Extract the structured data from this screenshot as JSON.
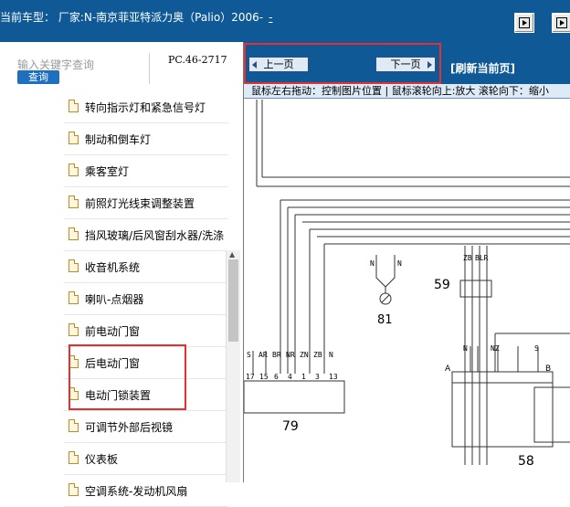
{
  "header": {
    "model_text": "当前车型： 厂家:N-南京菲亚特派力奥（Palio）2006-",
    "dash": "-"
  },
  "search": {
    "label": "输入关键字查询",
    "button": "查询",
    "code": "PC.46-2717"
  },
  "tree": {
    "items": [
      {
        "label": "转向指示灯和紧急信号灯"
      },
      {
        "label": "制动和倒车灯"
      },
      {
        "label": "乘客室灯"
      },
      {
        "label": "前照灯光线束调整装置"
      },
      {
        "label": "挡风玻璃/后风窗刮水器/洗涤"
      },
      {
        "label": "收音机系统"
      },
      {
        "label": "喇叭-点烟器"
      },
      {
        "label": "前电动门窗"
      },
      {
        "label": "后电动门窗"
      },
      {
        "label": "电动门锁装置"
      },
      {
        "label": "可调节外部后视镜"
      },
      {
        "label": "仪表板"
      },
      {
        "label": "空调系统-发动机风扇"
      }
    ]
  },
  "viewer": {
    "prev_label": "上一页",
    "next_label": "下一页",
    "refresh_label": "[刷新当前页]",
    "hint": "鼠标左右拖动：控制图片位置 | 鼠标滚轮向上:放大  滚轮向下：缩小"
  },
  "diagram": {
    "connector_left_pins": [
      "S",
      "AR",
      "BR",
      "NR",
      "ZN",
      "ZB",
      "N"
    ],
    "connector_left_nums": [
      "17",
      "15",
      "6",
      "4",
      "1",
      "3",
      "13"
    ],
    "right_pins": [
      "ZB",
      "BLR"
    ],
    "labels": {
      "n59": "59",
      "n81": "81",
      "n79": "79",
      "n58": "58",
      "a": "A",
      "b": "B",
      "nz": "NZ",
      "n": "N",
      "s": "S"
    }
  },
  "colors": {
    "bar_blue": "#0f5a96",
    "highlight_red": "#e53030",
    "hint_bg": "#ddeaf7"
  }
}
